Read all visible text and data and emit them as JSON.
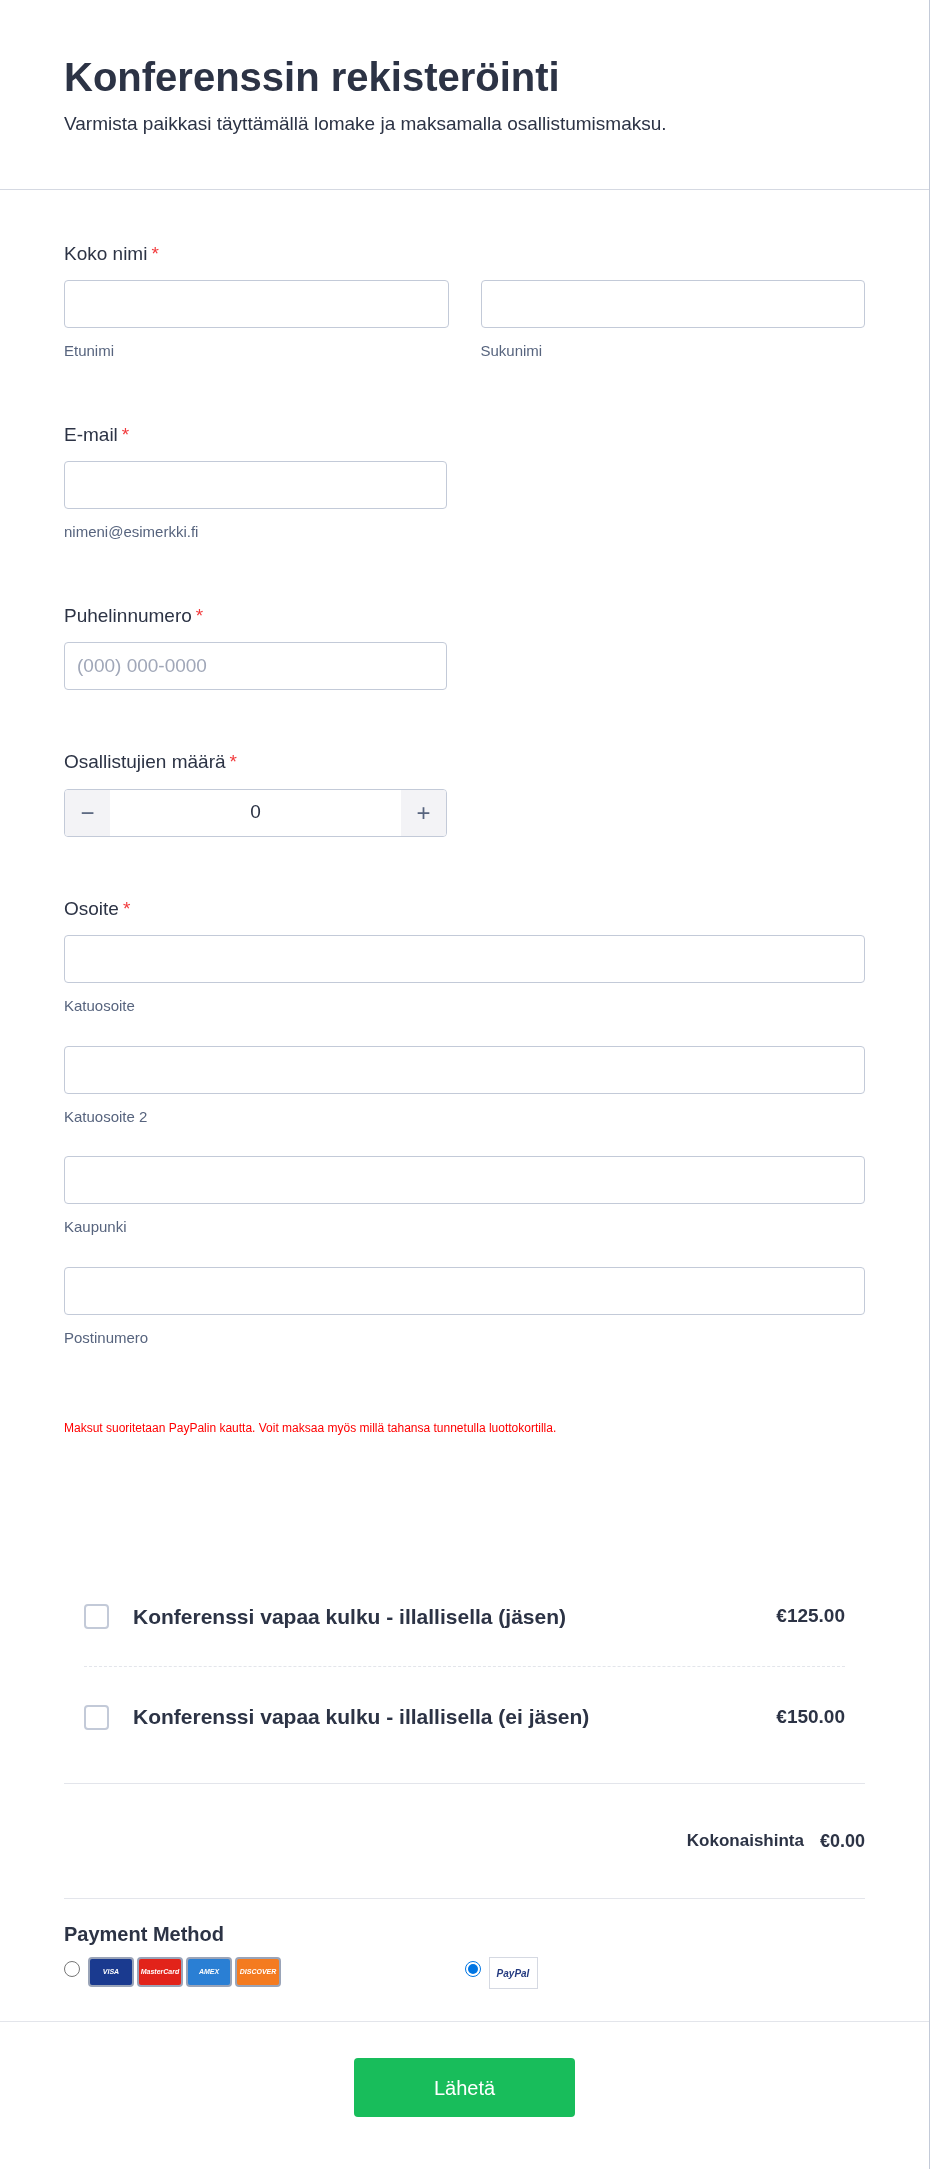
{
  "header": {
    "title": "Konferenssin rekisteröinti",
    "subtitle": "Varmista paikkasi täyttämällä lomake ja maksamalla osallistumismaksu."
  },
  "fields": [
    {
      "kind": "name",
      "label": "Koko nimi",
      "required_mark": "*",
      "parts": [
        {
          "hint": "Etunimi"
        },
        {
          "hint": "Sukunimi"
        }
      ]
    },
    {
      "kind": "text",
      "label": "E-mail",
      "required_mark": "*",
      "hint": "nimeni@esimerkki.fi"
    },
    {
      "kind": "phone",
      "label": "Puhelinnumero",
      "required_mark": "*",
      "placeholder": "(000) 000-0000"
    },
    {
      "kind": "stepper",
      "label": "Osallistujien määrä",
      "required_mark": "*",
      "value": "0",
      "minus": "−",
      "plus": "+"
    },
    {
      "kind": "address",
      "label": "Osoite",
      "required_mark": "*",
      "parts": [
        {
          "hint": "Katuosoite"
        },
        {
          "hint": "Katuosoite 2"
        },
        {
          "hint": "Kaupunki"
        },
        {
          "hint": "Postinumero"
        }
      ]
    }
  ],
  "note": "Maksut suoritetaan PayPalin kautta. Voit maksaa myös millä tahansa tunnetulla luottokortilla.",
  "products": [
    {
      "name": "Konferenssi vapaa kulku - illallisella (jäsen)",
      "price": "€125.00",
      "checked": false
    },
    {
      "name": "Konferenssi vapaa kulku - illallisella (ei jäsen)",
      "price": "€150.00",
      "checked": false
    }
  ],
  "total": {
    "label": "Kokonaishinta",
    "value": "€0.00"
  },
  "payment": {
    "title": "Payment Method",
    "options": [
      {
        "kind": "cards",
        "selected": false,
        "logos": [
          {
            "text": "VISA",
            "color": "#1a3a8f"
          },
          {
            "text": "MasterCard",
            "color": "#e2231a"
          },
          {
            "text": "AMEX",
            "color": "#2a7fd4"
          },
          {
            "text": "DISCOVER",
            "color": "#f47b20"
          }
        ]
      },
      {
        "kind": "paypal",
        "selected": true,
        "logos": [
          {
            "text": "PayPal",
            "color": "#253b80"
          }
        ]
      }
    ]
  },
  "submit": "Lähetä"
}
